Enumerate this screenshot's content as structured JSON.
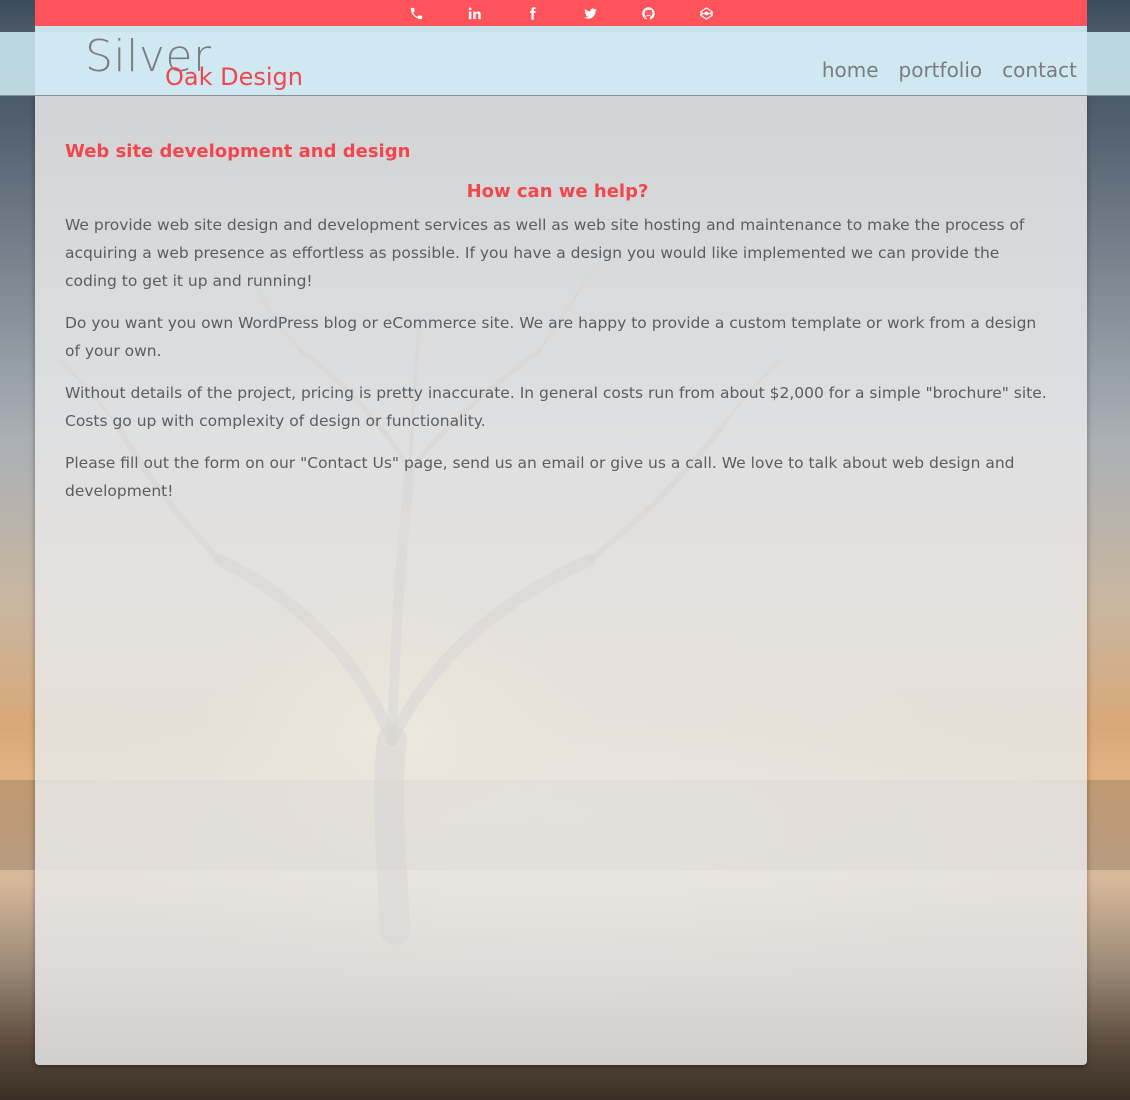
{
  "social": {
    "icons": [
      "phone-icon",
      "linkedin-icon",
      "facebook-icon",
      "twitter-icon",
      "github-icon",
      "codepen-icon"
    ]
  },
  "logo": {
    "word1": "Silver",
    "word2": "Oak Design"
  },
  "nav": {
    "items": [
      "home",
      "portfolio",
      "contact"
    ]
  },
  "main": {
    "heading": "Web site development and design",
    "subheading": "How can we help?",
    "paragraphs": [
      "We provide web site design and development services as well as web site hosting and maintenance to make the process of acquiring a web presence as effortless as possible. If you have a design you would like implemented we can provide the coding to get it up and running!",
      "Do you want you own WordPress blog or eCommerce site. We are happy to provide a custom template or work from a design of your own.",
      "Without details of the project, pricing is pretty inaccurate. In general costs run from about $2,000 for a simple \"brochure\" site. Costs go up with complexity of design or functionality.",
      "Please fill out the form on our \"Contact Us\" page, send us an email or give us a call. We love to talk about web design and development!"
    ]
  },
  "colors": {
    "accent": "#ff535b",
    "heading": "#f0474f",
    "text": "#5b5d60"
  }
}
